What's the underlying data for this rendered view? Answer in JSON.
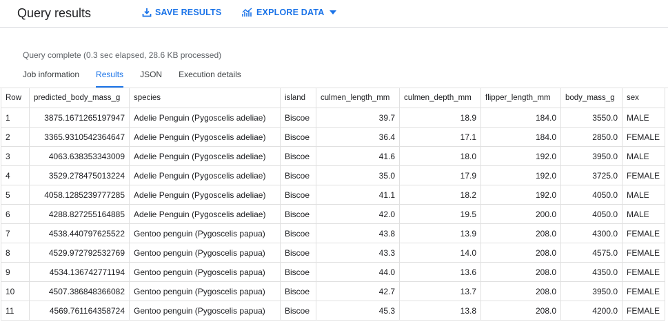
{
  "header": {
    "title": "Query results",
    "save_label": "SAVE RESULTS",
    "explore_label": "EXPLORE DATA"
  },
  "status": "Query complete (0.3 sec elapsed, 28.6 KB processed)",
  "tabs": [
    {
      "label": "Job information",
      "active": false
    },
    {
      "label": "Results",
      "active": true
    },
    {
      "label": "JSON",
      "active": false
    },
    {
      "label": "Execution details",
      "active": false
    }
  ],
  "table": {
    "columns": [
      "Row",
      "predicted_body_mass_g",
      "species",
      "island",
      "culmen_length_mm",
      "culmen_depth_mm",
      "flipper_length_mm",
      "body_mass_g",
      "sex"
    ],
    "rows": [
      [
        "1",
        "3875.1671265197947",
        "Adelie Penguin (Pygoscelis adeliae)",
        "Biscoe",
        "39.7",
        "18.9",
        "184.0",
        "3550.0",
        "MALE"
      ],
      [
        "2",
        "3365.9310542364647",
        "Adelie Penguin (Pygoscelis adeliae)",
        "Biscoe",
        "36.4",
        "17.1",
        "184.0",
        "2850.0",
        "FEMALE"
      ],
      [
        "3",
        "4063.638353343009",
        "Adelie Penguin (Pygoscelis adeliae)",
        "Biscoe",
        "41.6",
        "18.0",
        "192.0",
        "3950.0",
        "MALE"
      ],
      [
        "4",
        "3529.278475013224",
        "Adelie Penguin (Pygoscelis adeliae)",
        "Biscoe",
        "35.0",
        "17.9",
        "192.0",
        "3725.0",
        "FEMALE"
      ],
      [
        "5",
        "4058.1285239777285",
        "Adelie Penguin (Pygoscelis adeliae)",
        "Biscoe",
        "41.1",
        "18.2",
        "192.0",
        "4050.0",
        "MALE"
      ],
      [
        "6",
        "4288.827255164885",
        "Adelie Penguin (Pygoscelis adeliae)",
        "Biscoe",
        "42.0",
        "19.5",
        "200.0",
        "4050.0",
        "MALE"
      ],
      [
        "7",
        "4538.440797625522",
        "Gentoo penguin (Pygoscelis papua)",
        "Biscoe",
        "43.8",
        "13.9",
        "208.0",
        "4300.0",
        "FEMALE"
      ],
      [
        "8",
        "4529.972792532769",
        "Gentoo penguin (Pygoscelis papua)",
        "Biscoe",
        "43.3",
        "14.0",
        "208.0",
        "4575.0",
        "FEMALE"
      ],
      [
        "9",
        "4534.136742771194",
        "Gentoo penguin (Pygoscelis papua)",
        "Biscoe",
        "44.0",
        "13.6",
        "208.0",
        "4350.0",
        "FEMALE"
      ],
      [
        "10",
        "4507.386848366082",
        "Gentoo penguin (Pygoscelis papua)",
        "Biscoe",
        "42.7",
        "13.7",
        "208.0",
        "3950.0",
        "FEMALE"
      ],
      [
        "11",
        "4569.761164358724",
        "Gentoo penguin (Pygoscelis papua)",
        "Biscoe",
        "45.3",
        "13.8",
        "208.0",
        "4200.0",
        "FEMALE"
      ]
    ]
  },
  "colors": {
    "accent": "#1a73e8",
    "text": "#202124",
    "muted": "#5f6368",
    "border": "#e0e0e0"
  },
  "icons": {
    "save": "download-icon",
    "explore": "chart-icon",
    "dropdown": "caret-down-icon"
  }
}
